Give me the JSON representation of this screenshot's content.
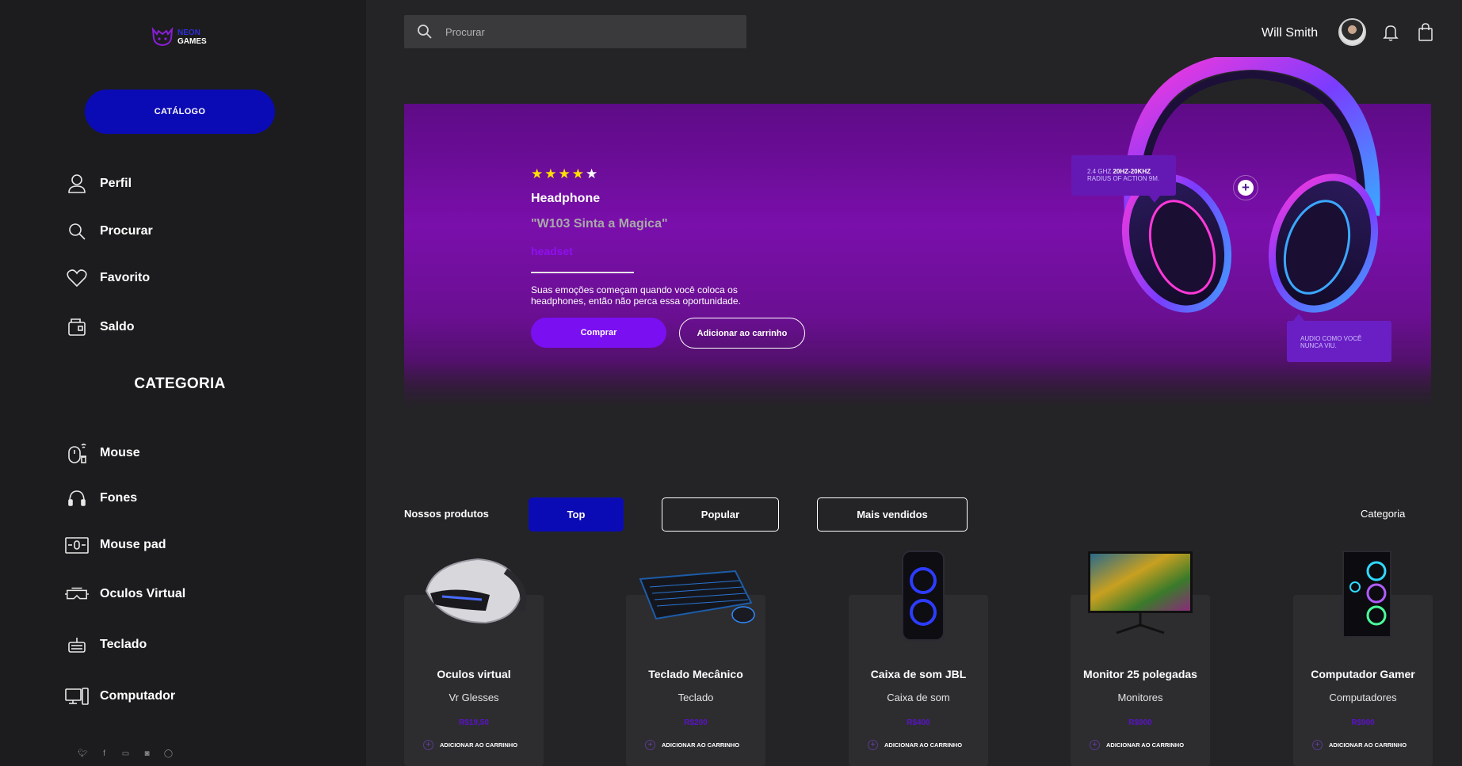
{
  "brand": {
    "logo_line1": "NEON",
    "logo_line2": "GAMES"
  },
  "sidebar": {
    "catalog_label": "CATÁLOGO",
    "menu": [
      {
        "label": "Perfil",
        "icon": "user-icon"
      },
      {
        "label": "Procurar",
        "icon": "search-icon"
      },
      {
        "label": "Favorito",
        "icon": "heart-icon"
      },
      {
        "label": "Saldo",
        "icon": "wallet-icon"
      }
    ],
    "category_title": "CATEGORIA",
    "categories": [
      {
        "label": "Mouse",
        "icon": "mouse-icon"
      },
      {
        "label": "Fones",
        "icon": "headphones-icon"
      },
      {
        "label": "Mouse pad",
        "icon": "mousepad-icon"
      },
      {
        "label": "Oculos Virtual",
        "icon": "vr-icon"
      },
      {
        "label": "Teclado",
        "icon": "keyboard-icon"
      },
      {
        "label": "Computador",
        "icon": "computer-icon"
      }
    ],
    "socials": [
      "twitter-icon",
      "facebook-icon",
      "youtube-icon",
      "instagram-icon",
      "whatsapp-icon"
    ]
  },
  "header": {
    "search_placeholder": "Procurar",
    "user_name": "Will Smith"
  },
  "hero": {
    "stars_filled": "★★★★",
    "stars_empty": "★",
    "category": "Headphone",
    "name": "\"W103 Sinta a Magica\"",
    "tag": "headset",
    "description": "Suas emoções começam quando você coloca os headphones, então não perca essa oportunidade.",
    "buy_label": "Comprar",
    "add_cart_label": "Adicionar ao carrinho",
    "tip1_prefix": "2.4 GHZ",
    "tip1_bold": "20HZ-20KHZ",
    "tip1_line2": "RADIUS OF ACTION 9M.",
    "tip2": "AUDIO COMO VOCÊ NUNCA VIU.",
    "plus": "+"
  },
  "products_section": {
    "label": "Nossos produtos",
    "tabs": [
      "Top",
      "Popular",
      "Mais vendidos"
    ],
    "active_tab": "Top",
    "category_link": "Categoria"
  },
  "products": [
    {
      "title": "Oculos virtual",
      "category": "Vr Glesses",
      "price": "R$19,50",
      "add": "ADICIONAR AO CARRINHO"
    },
    {
      "title": "Teclado Mecânico",
      "category": "Teclado",
      "price": "R$200",
      "add": "ADICIONAR AO CARRINHO"
    },
    {
      "title": "Caixa de som JBL",
      "category": "Caixa de som",
      "price": "R$400",
      "add": "ADICIONAR AO CARRINHO"
    },
    {
      "title": "Monitor 25 polegadas",
      "category": "Monitores",
      "price": "R$900",
      "add": "ADICIONAR AO CARRINHO"
    },
    {
      "title": "Computador Gamer",
      "category": "Computadores",
      "price": "R$900",
      "add": "ADICIONAR AO CARRINHO"
    }
  ],
  "colors": {
    "accent_blue": "#0b0bb5",
    "accent_purple": "#7a0ff2",
    "hero_bg": "#7a0fab",
    "sidebar_bg": "#1c1c1e",
    "page_bg": "#242426"
  }
}
